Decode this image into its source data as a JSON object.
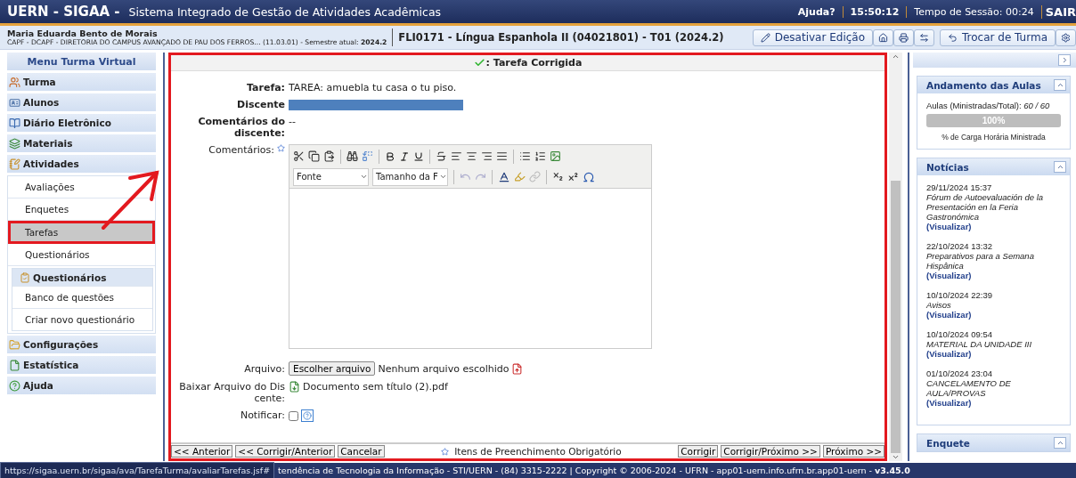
{
  "header": {
    "logo": "UERN - SIGAA -",
    "system_name": "Sistema Integrado de Gestão de Atividades Acadêmicas",
    "help": "Ajuda?",
    "clock": "15:50:12",
    "session": "Tempo de Sessão: 00:24",
    "logout": "SAIR"
  },
  "user_bar": {
    "user_name": "Maria Eduarda Bento de Morais",
    "unit": "CAPF - DCAPF - DIRETORIA DO CAMPUS AVANÇADO DE PAU DOS FERROS... (11.03.01) - Semestre atual: **2024.2**",
    "course": "FLI0171 - Língua Espanhola II (04021801) - T01 (2024.2)",
    "buttons": [
      {
        "kind": "edit",
        "label": "Desativar Edição"
      },
      {
        "kind": "home"
      },
      {
        "kind": "print"
      },
      {
        "kind": "swap"
      },
      {
        "kind": "back",
        "label": "Trocar de Turma"
      },
      {
        "kind": "gear"
      }
    ]
  },
  "sidebar": {
    "title": "Menu Turma Virtual",
    "sections": [
      {
        "label": "Turma"
      },
      {
        "label": "Alunos"
      },
      {
        "label": "Diário Eletrônico"
      },
      {
        "label": "Materiais"
      },
      {
        "label": "Atividades",
        "children": [
          {
            "kind": "link",
            "label": "Avaliações",
            "selected": false
          },
          {
            "kind": "link",
            "label": "Enquetes",
            "selected": false
          },
          {
            "kind": "link",
            "label": "Tarefas",
            "selected": true
          },
          {
            "kind": "link",
            "label": "Questionários",
            "selected": false
          },
          {
            "kind": "group",
            "label": "Questionários",
            "children": [
              {
                "label": "Banco de questões"
              },
              {
                "label": "Criar novo questionário"
              }
            ]
          }
        ]
      },
      {
        "label": "Configurações"
      },
      {
        "label": "Estatística"
      },
      {
        "label": "Ajuda"
      }
    ]
  },
  "form": {
    "title": ": Tarefa Corrigida",
    "task_label": "Tarefa:",
    "task_value": "TAREA: amuebla tu casa o tu piso.",
    "student_label": "Discente",
    "student_comments_label": "Comentários do discente:",
    "student_comments_value": "--",
    "comments_label": "Comentários:",
    "editor": {
      "font_select": "Fonte",
      "size_select": "Tamanho da F"
    },
    "file_label": "Arquivo:",
    "file_button": "Escolher arquivo",
    "file_status": "Nenhum arquivo escolhido",
    "download_label": "Baixar Arquivo do Discente:",
    "download_file": "Documento sem título (2).pdf",
    "notify_label": "Notificar:",
    "notify_checked": false,
    "left_buttons": [
      "<< Anterior",
      "<< Corrigir/Anterior",
      "Cancelar"
    ],
    "required_note": "Itens de Preenchimento Obrigatório",
    "right_buttons": [
      "Corrigir",
      "Corrigir/Próximo >>",
      "Próximo >>"
    ]
  },
  "right_panel": {
    "progress": {
      "title": "Andamento das Aulas",
      "label": "Aulas (Ministradas/Total):",
      "value": "60 / 60",
      "level": 1,
      "percent": "100%",
      "caption": "% de Carga Horária Ministrada"
    },
    "news": {
      "title": "Notícias",
      "items": [
        {
          "date": "29/11/2024 15:37",
          "title": "Fórum de Autoevaluación de la Presentación en la Feria Gastronómica",
          "link": "(Visualizar)"
        },
        {
          "date": "22/10/2024 13:32",
          "title": "Preparativos para a Semana Hispânica",
          "link": "(Visualizar)"
        },
        {
          "date": "10/10/2024 22:39",
          "title": "Avisos",
          "link": "(Visualizar)"
        },
        {
          "date": "10/10/2024 09:54",
          "title": "MATERIAL DA UNIDADE III",
          "link": "(Visualizar)"
        },
        {
          "date": "01/10/2024 23:04",
          "title": "CANCELAMENTO DE AULA/PROVAS",
          "link": "(Visualizar)"
        }
      ]
    },
    "poll": {
      "title": "Enquete"
    }
  },
  "footer": {
    "status_url": "https://sigaa.uern.br/sigaa/ava/TarefaTurma/avaliarTarefas.jsf#",
    "text": "tendência de Tecnologia da Informação - STI/UERN - (84) 3315-2222 | Copyright © 2006-2024 - UFRN - app01-uern.info.ufrn.br.app01-uern - **v3.45.0**"
  }
}
